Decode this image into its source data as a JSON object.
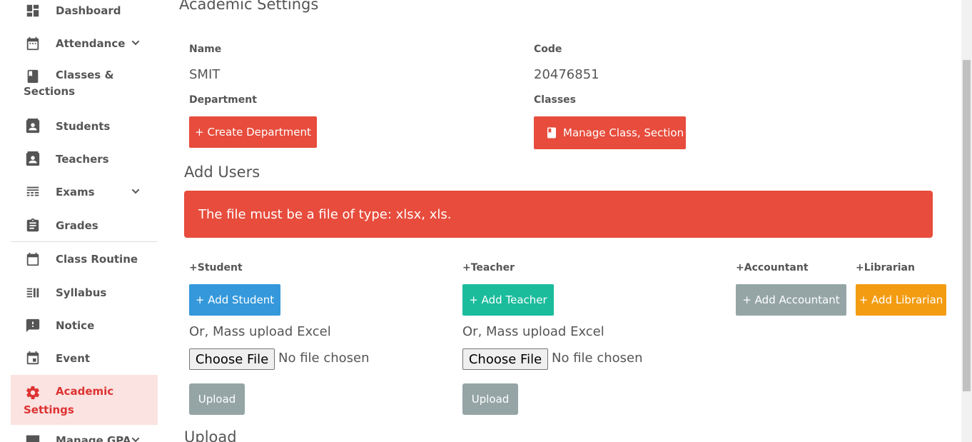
{
  "sidebar": {
    "items": [
      {
        "label": "Dashboard",
        "icon": "dashboard-icon"
      },
      {
        "label": "Attendance",
        "icon": "calendar-icon"
      },
      {
        "label": "Classes &",
        "label2": "Sections",
        "icon": "book-icon"
      },
      {
        "label": "Students",
        "icon": "id-card-icon"
      },
      {
        "label": "Teachers",
        "icon": "id-card-icon"
      },
      {
        "label": "Exams",
        "icon": "exams-icon"
      },
      {
        "label": "Grades",
        "icon": "clipboard-icon"
      },
      {
        "label": "Class Routine",
        "icon": "calendar-blank-icon"
      },
      {
        "label": "Syllabus",
        "icon": "list-icon"
      },
      {
        "label": "Notice",
        "icon": "alert-message-icon"
      },
      {
        "label": "Event",
        "icon": "event-icon"
      },
      {
        "label": "Academic",
        "label2": "Settings",
        "icon": "gear-icon"
      },
      {
        "label": "Manage GPA",
        "icon": "gpa-icon"
      }
    ],
    "active_color": "#dd3333"
  },
  "main": {
    "page_title": "Academic Settings",
    "name_label": "Name",
    "name_value": "SMIT",
    "code_label": "Code",
    "code_value": "20476851",
    "department_label": "Department",
    "classes_label": "Classes",
    "create_department_btn": "+ Create Department",
    "manage_class_btn": "Manage Class, Section",
    "add_users_title": "Add Users",
    "alert_text": "The file must be a file of type: xlsx, xls.",
    "student_label": "+Student",
    "teacher_label": "+Teacher",
    "accountant_label": "+Accountant",
    "librarian_label": "+Librarian",
    "add_student_btn": "+ Add Student",
    "add_teacher_btn": "+ Add Teacher",
    "add_accountant_btn": "+ Add Accountant",
    "add_librarian_btn": "+ Add Librarian",
    "mass_upload_text": "Or, Mass upload Excel",
    "choose_file_btn": "Choose File",
    "no_file_text": "No file chosen",
    "upload_btn": "Upload",
    "upload_title": "Upload"
  },
  "colors": {
    "red": "#e74c3c",
    "blue": "#3498db",
    "teal": "#1abc9c",
    "gray": "#95a5a6",
    "orange": "#f39c12"
  }
}
